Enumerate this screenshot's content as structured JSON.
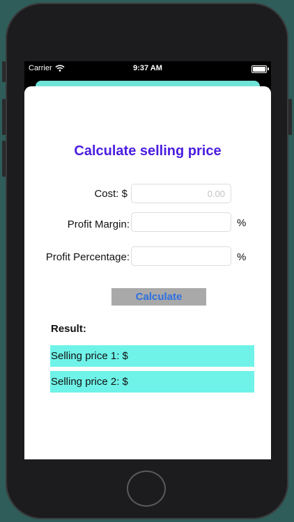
{
  "status_bar": {
    "carrier": "Carrier",
    "time": "9:37 AM"
  },
  "form": {
    "title": "Calculate selling price",
    "cost_label": "Cost: $",
    "cost_placeholder": "0.00",
    "cost_value": "",
    "margin_label": "Profit Margin:",
    "margin_value": "",
    "margin_unit": "%",
    "percentage_label": "Profit Percentage:",
    "percentage_value": "",
    "percentage_unit": "%",
    "calculate_label": "Calculate"
  },
  "result": {
    "label": "Result:",
    "selling_price_1": "Selling price 1: $",
    "selling_price_2": "Selling price 2: $"
  },
  "colors": {
    "title": "#4b1de0",
    "accent_cyan": "#6ff3e8",
    "button_bg": "#a9a9a9",
    "button_text": "#2f6fe0",
    "background": "#2f5d59"
  },
  "icons": [
    "wifi-icon",
    "battery-icon"
  ]
}
